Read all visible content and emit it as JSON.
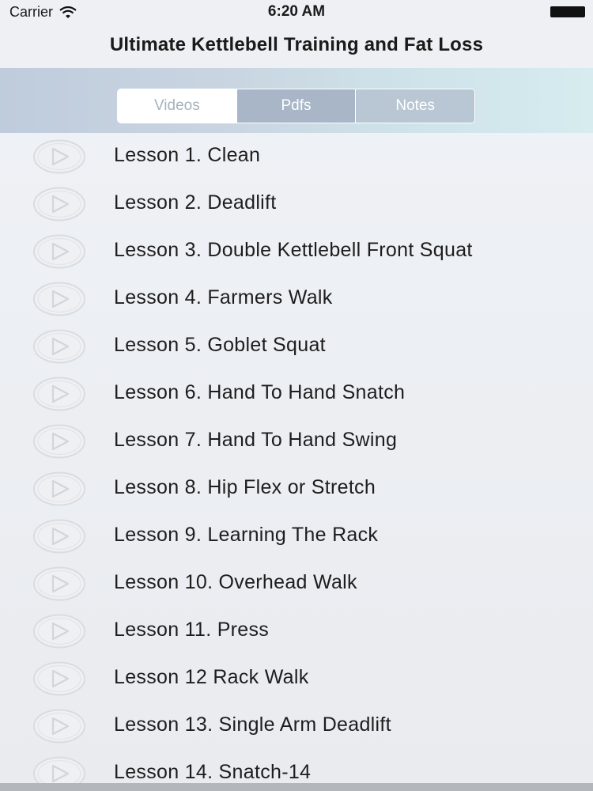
{
  "status_bar": {
    "carrier": "Carrier",
    "time": "6:20 AM",
    "wifi_icon": "wifi-icon",
    "battery_icon": "battery-icon"
  },
  "nav": {
    "title": "Ultimate Kettlebell Training and Fat Loss"
  },
  "segments": {
    "items": [
      {
        "label": "Videos",
        "selected": true
      },
      {
        "label": "Pdfs",
        "selected": false
      },
      {
        "label": "Notes",
        "selected": false
      }
    ]
  },
  "lessons": {
    "icon": "play-circle-icon",
    "items": [
      {
        "label": "Lesson 1. Clean"
      },
      {
        "label": "Lesson 2. Deadlift"
      },
      {
        "label": "Lesson 3. Double Kettlebell Front Squat"
      },
      {
        "label": "Lesson 4. Farmers Walk"
      },
      {
        "label": "Lesson 5. Goblet Squat"
      },
      {
        "label": "Lesson 6. Hand To Hand Snatch"
      },
      {
        "label": "Lesson 7. Hand To Hand Swing"
      },
      {
        "label": "Lesson 8. Hip Flex or Stretch"
      },
      {
        "label": "Lesson 9. Learning The Rack"
      },
      {
        "label": "Lesson 10. Overhead Walk"
      },
      {
        "label": "Lesson 11. Press"
      },
      {
        "label": "Lesson 12 Rack Walk"
      },
      {
        "label": "Lesson 13. Single Arm Deadlift"
      },
      {
        "label": "Lesson 14. Snatch-14"
      }
    ]
  },
  "colors": {
    "header_gradient_start": "#bfccdc",
    "header_gradient_end": "#d6ecef",
    "segment_inactive": "#a8b6c8",
    "segment_active_bg": "#ffffff",
    "segment_active_text": "#a7b1bd",
    "list_bg": "#eef1f5",
    "icon_stroke": "#d6d9de"
  }
}
